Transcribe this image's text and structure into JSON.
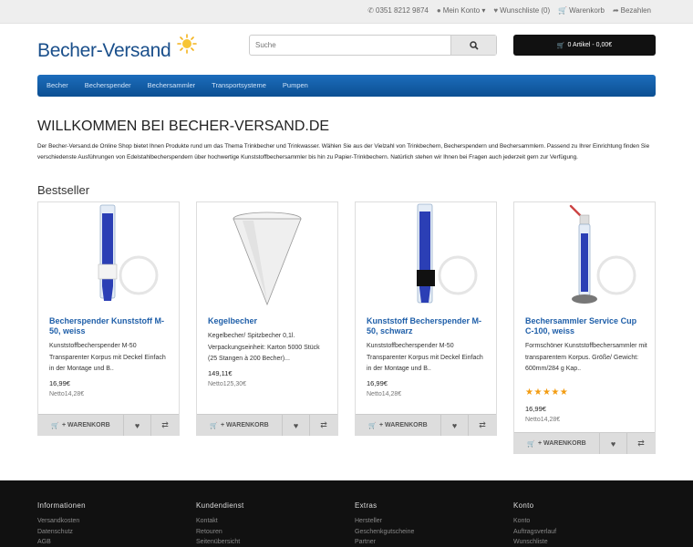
{
  "topbar": {
    "phone": "0351 8212 9874",
    "account": "Mein Konto",
    "wishlist": "Wunschliste (0)",
    "cart": "Warenkorb",
    "checkout": "Bezahlen"
  },
  "header": {
    "logo_text": "Becher-Versand",
    "search_placeholder": "Suche",
    "cart_summary": "0 Artikel - 0,00€"
  },
  "nav": {
    "items": [
      "Becher",
      "Becherspender",
      "Bechersammler",
      "Transportsysteme",
      "Pumpen"
    ]
  },
  "main": {
    "title": "WILLKOMMEN BEI BECHER-VERSAND.DE",
    "intro": "Der Becher-Versand.de Online Shop bietet Ihnen Produkte rund um das Thema Trinkbecher und Trinkwasser. Wählen Sie aus der Vielzahl von Trinkbechern, Becherspendern und Bechersammlern. Passend zu Ihrer Einrichtung finden Sie verschiedenste Ausführungen von Edelstahlbecherspendern über hochwertige Kunststoffbechersammler bis hin zu Papier-Trinkbechern. Natürlich stehen wir Ihnen bei Fragen auch jederzeit gern zur Verfügung.",
    "section_title": "Bestseller"
  },
  "buttons": {
    "add_to_cart": "+ WARENKORB"
  },
  "products": [
    {
      "name": "Becherspender Kunststoff M-50, weiss",
      "desc": "Kunststoffbecherspender M-50 Transparenter Korpus mit Deckel Einfach in der Montage und B..",
      "price": "16,99€",
      "netto": "Netto14,28€",
      "rating": 0
    },
    {
      "name": "Kegelbecher",
      "desc": "Kegelbecher/ Spitzbecher 0,1l. Verpackungseinheit: Karton 5000 Stück (25 Stangen à 200 Becher)...",
      "price": "149,11€",
      "netto": "Netto125,30€",
      "rating": 0
    },
    {
      "name": "Kunststoff Becherspender M-50, schwarz",
      "desc": "Kunststoffbecherspender M-50 Transparenter Korpus mit Deckel Einfach in der Montage und B..",
      "price": "16,99€",
      "netto": "Netto14,28€",
      "rating": 0
    },
    {
      "name": "Bechersammler Service Cup C-100, weiss",
      "desc": "Formschöner Kunststoffbechersammler mit transparentem Korpus. Größe/ Gewicht: 600mm/284 g Kap..",
      "price": "16,99€",
      "netto": "Netto14,28€",
      "rating": 5
    }
  ],
  "footer": {
    "columns": [
      {
        "title": "Informationen",
        "links": [
          "Versandkosten",
          "Datenschutz",
          "AGB"
        ]
      },
      {
        "title": "Kundendienst",
        "links": [
          "Kontakt",
          "Retouren",
          "Seitenübersicht"
        ]
      },
      {
        "title": "Extras",
        "links": [
          "Hersteller",
          "Geschenkgutscheine",
          "Partner"
        ]
      },
      {
        "title": "Konto",
        "links": [
          "Konto",
          "Auftragsverlauf",
          "Wunschliste"
        ]
      }
    ]
  },
  "colors": {
    "brand_blue": "#1a4f8b",
    "nav_blue": "#0c4f92",
    "link_blue": "#1f5fa9",
    "star": "#f39c12",
    "footer_bg": "#111111"
  }
}
